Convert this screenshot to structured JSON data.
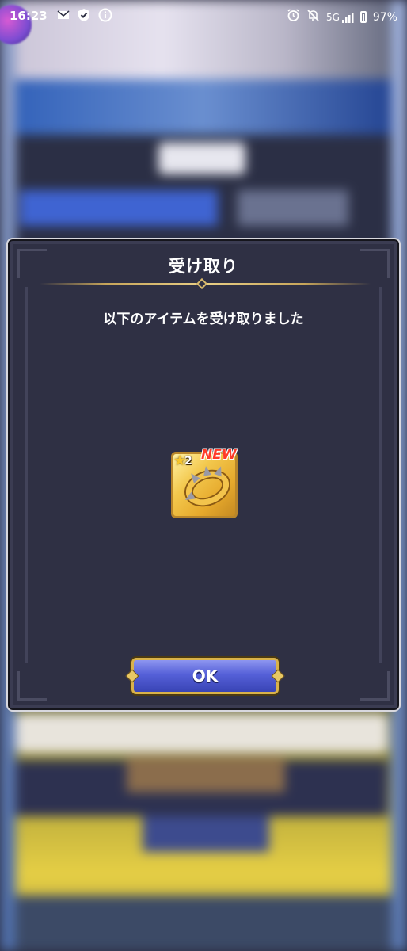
{
  "status_bar": {
    "time": "16:23",
    "left_icons": [
      "mail-notification-icon",
      "shield-check-icon",
      "info-icon"
    ],
    "right_icons": [
      "alarm-icon",
      "bell-off-icon",
      "signal-5g-icon",
      "battery-icon"
    ],
    "network": "5G",
    "battery": "97%"
  },
  "dialog": {
    "title": "受け取り",
    "message": "以下のアイテムを受け取りました",
    "item": {
      "icon": "golden-ring-icon",
      "rarity": "2",
      "badge": "NEW"
    },
    "ok_label": "OK"
  },
  "colors": {
    "dialog_bg": "#2f3044",
    "gold": "#d9b24a",
    "button_blue": "#5560d8",
    "new_red": "#ff3b28"
  }
}
